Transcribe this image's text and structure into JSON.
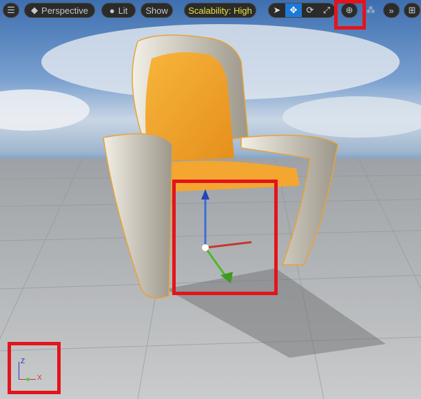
{
  "toolbar": {
    "menu_icon": "hamburger-icon",
    "perspective_label": "Perspective",
    "lit_label": "Lit",
    "show_label": "Show",
    "scalability_label": "Scalability: High",
    "scalability_color": "#e8e23a",
    "tools": [
      {
        "name": "select",
        "icon": "cursor-icon",
        "active": false
      },
      {
        "name": "translate",
        "icon": "move-icon",
        "active": true
      },
      {
        "name": "rotate",
        "icon": "rotate-icon",
        "active": false
      },
      {
        "name": "scale",
        "icon": "scale-icon",
        "active": false
      }
    ],
    "world_local_icon": "globe-icon",
    "snap_icon": "surface-snap-icon",
    "more_label": "»",
    "layout_icon": "grid-layout-icon",
    "accent": "#1d7ad6"
  },
  "axis_indicator": {
    "z": "Z",
    "x": "X"
  },
  "highlight_color": "#e3141b"
}
